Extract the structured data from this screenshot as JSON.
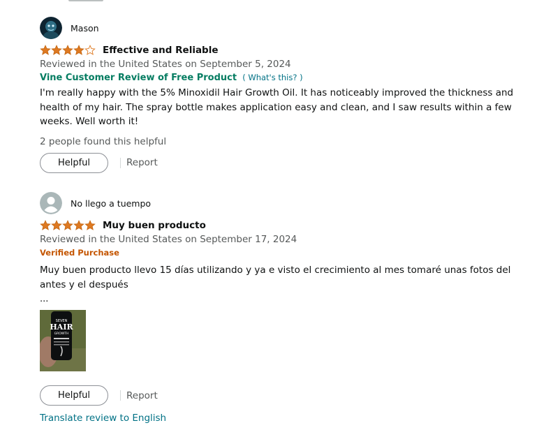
{
  "reviews": [
    {
      "reviewer": "Mason",
      "stars": 4,
      "title": "Effective and Reliable",
      "date": "Reviewed in the United States on September 5, 2024",
      "badge": "Vine Customer Review of Free Product",
      "badge_link": "( What's this? )",
      "body": "I'm really happy with the 5% Minoxidil Hair Growth Oil. It has noticeably improved the thickness and health of my hair. The spray bottle makes application easy and clean, and I saw results within a few weeks. Well worth it!",
      "helpful_count": "2 people found this helpful",
      "helpful_label": "Helpful",
      "report_label": "Report"
    },
    {
      "reviewer": "No llego a tuempo",
      "stars": 5,
      "title": "Muy buen producto",
      "date": "Reviewed in the United States on September 17, 2024",
      "badge": "Verified Purchase",
      "body": "Muy buen producto llevo 15 días utilizando y ya e visto el crecimiento al mes tomaré unas fotos del antes y el después",
      "ellipsis": "...",
      "image_text": [
        "SEVEN",
        "HAIR",
        "GROWTH"
      ],
      "helpful_label": "Helpful",
      "report_label": "Report"
    }
  ],
  "translate_link": "Translate review to English",
  "colors": {
    "star": "#de7921",
    "vine": "#067d62",
    "verified": "#c45500",
    "link": "#007185",
    "muted": "#565959"
  }
}
